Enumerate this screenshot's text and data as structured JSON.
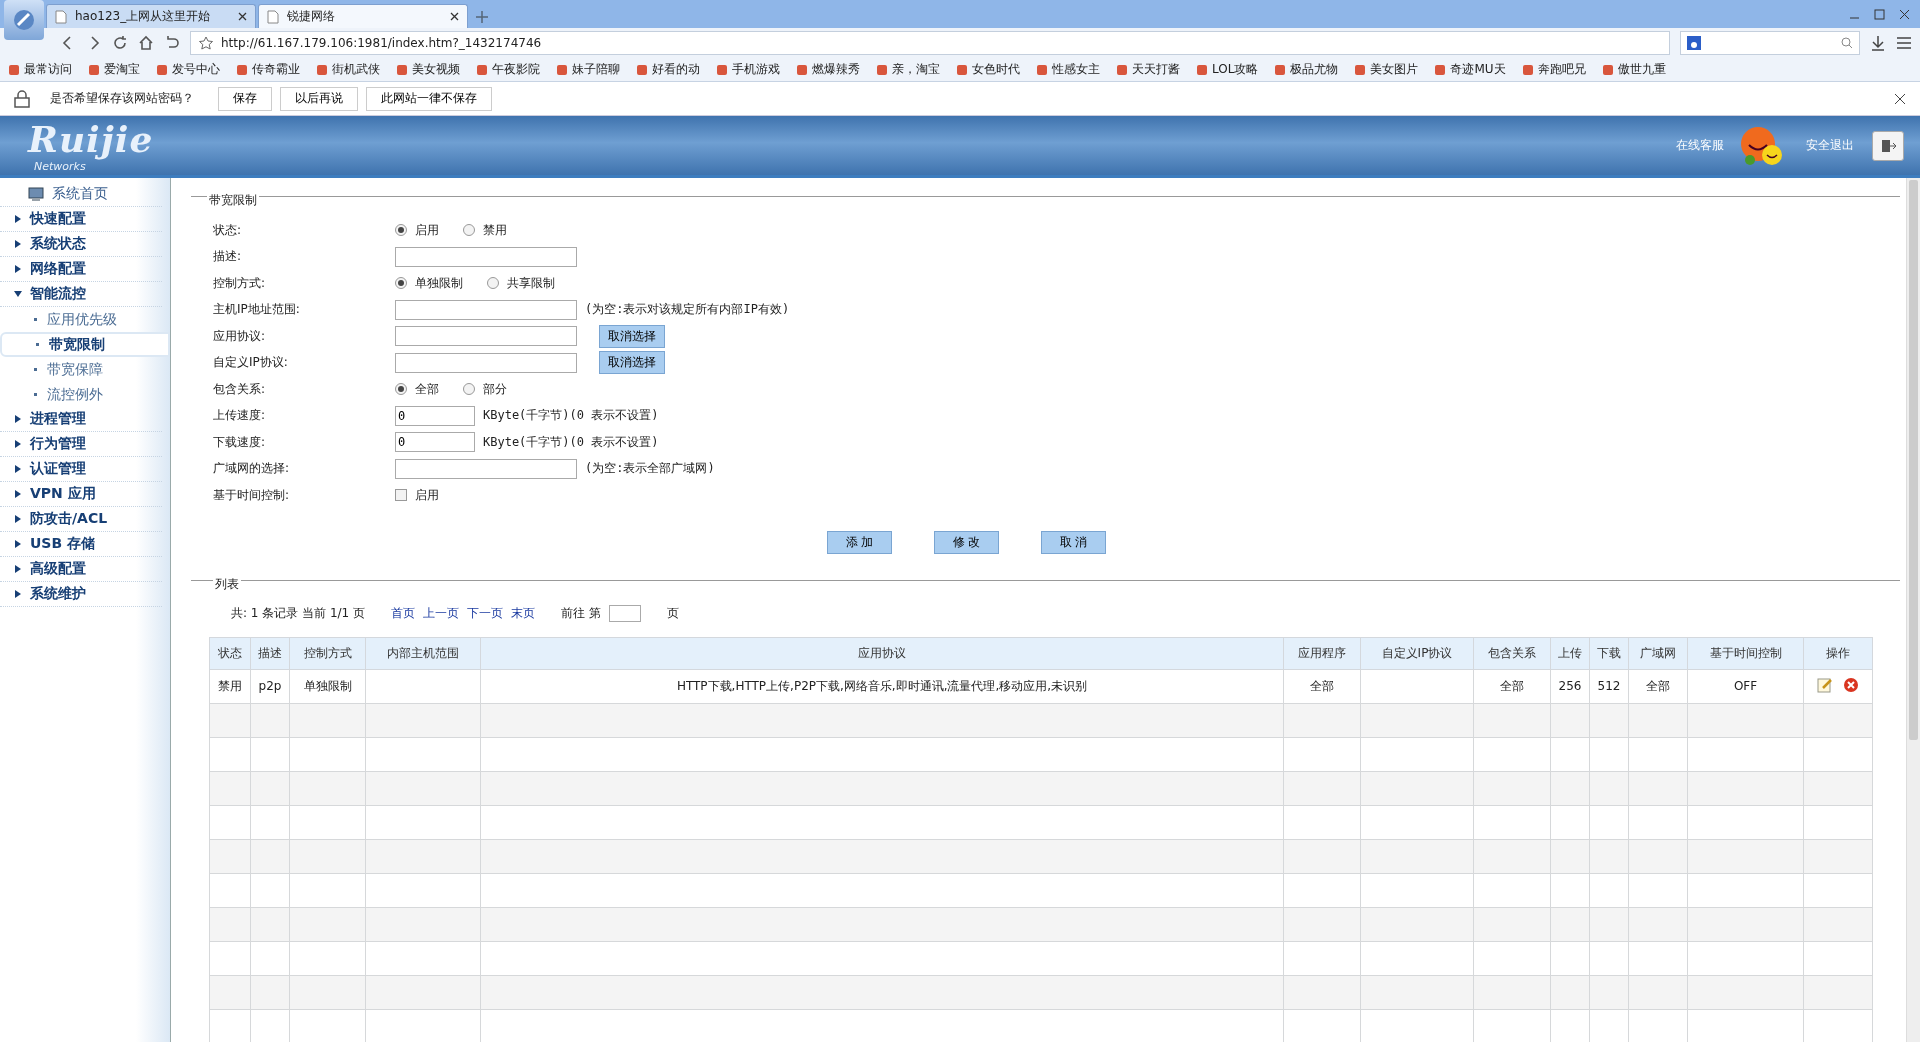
{
  "browser": {
    "tabs": [
      {
        "label": "hao123_上网从这里开始",
        "selected": false
      },
      {
        "label": "锐捷网络",
        "selected": true
      }
    ],
    "url": "http://61.167.179.106:1981/index.htm?_1432174746",
    "bookmarks": [
      "最常访问",
      "爱淘宝",
      "发号中心",
      "传奇霸业",
      "街机武侠",
      "美女视频",
      "午夜影院",
      "妹子陪聊",
      "好看的动",
      "手机游戏",
      "燃爆辣秀",
      "亲，淘宝",
      "女色时代",
      "性感女主",
      "天天打酱",
      "LOL攻略",
      "极品尤物",
      "美女图片",
      "奇迹MU天",
      "奔跑吧兄",
      "傲世九重"
    ],
    "password_prompt": {
      "message": "是否希望保存该网站密码？",
      "buttons": [
        "保存",
        "以后再说",
        "此网站一律不保存"
      ]
    }
  },
  "header": {
    "logo": "Ruijie",
    "logo_sub": "Networks",
    "service_link": "在线客服",
    "logout_link": "安全退出"
  },
  "sidebar": {
    "items": [
      {
        "kind": "home",
        "label": "系统首页"
      },
      {
        "kind": "group",
        "label": "快速配置",
        "expanded": false
      },
      {
        "kind": "group",
        "label": "系统状态",
        "expanded": false
      },
      {
        "kind": "group",
        "label": "网络配置",
        "expanded": false
      },
      {
        "kind": "group",
        "label": "智能流控",
        "expanded": true,
        "children": [
          {
            "label": "应用优先级",
            "selected": false
          },
          {
            "label": "带宽限制",
            "selected": true
          },
          {
            "label": "带宽保障",
            "selected": false
          },
          {
            "label": "流控例外",
            "selected": false
          }
        ]
      },
      {
        "kind": "group",
        "label": "进程管理",
        "expanded": false
      },
      {
        "kind": "group",
        "label": "行为管理",
        "expanded": false
      },
      {
        "kind": "group",
        "label": "认证管理",
        "expanded": false
      },
      {
        "kind": "group",
        "label": "VPN 应用",
        "expanded": false
      },
      {
        "kind": "group",
        "label": "防攻击/ACL",
        "expanded": false
      },
      {
        "kind": "group",
        "label": "USB 存储",
        "expanded": false
      },
      {
        "kind": "group",
        "label": "高级配置",
        "expanded": false
      },
      {
        "kind": "group",
        "label": "系统维护",
        "expanded": false
      }
    ]
  },
  "form": {
    "legend": "带宽限制",
    "rows": [
      {
        "kind": "radio",
        "label": "状态:",
        "options": [
          {
            "label": "启用",
            "selected": true
          },
          {
            "label": "禁用",
            "selected": false
          }
        ]
      },
      {
        "kind": "text",
        "label": "描述:"
      },
      {
        "kind": "radio",
        "label": "控制方式:",
        "options": [
          {
            "label": "单独限制",
            "selected": true
          },
          {
            "label": "共享限制",
            "selected": false
          }
        ]
      },
      {
        "kind": "text",
        "label": "主机IP地址范围:",
        "note": "(为空:表示对该规定所有内部IP有效)"
      },
      {
        "kind": "text",
        "label": "应用协议:",
        "button": "取消选择"
      },
      {
        "kind": "text",
        "label": "自定义IP协议:",
        "button": "取消选择"
      },
      {
        "kind": "radio",
        "label": "包含关系:",
        "options": [
          {
            "label": "全部",
            "selected": true
          },
          {
            "label": "部分",
            "selected": false
          }
        ]
      },
      {
        "kind": "short",
        "label": "上传速度:",
        "value": "0",
        "note": "KByte(千字节)(0 表示不设置)"
      },
      {
        "kind": "short",
        "label": "下载速度:",
        "value": "0",
        "note": "KByte(千字节)(0 表示不设置)"
      },
      {
        "kind": "text",
        "label": "广域网的选择:",
        "note": "(为空:表示全部广域网)"
      },
      {
        "kind": "checkbox",
        "label": "基于时间控制:",
        "option": "启用",
        "checked": false
      }
    ],
    "buttons": [
      "添 加",
      "修 改",
      "取 消"
    ]
  },
  "list": {
    "legend": "列表",
    "summary": "共: 1 条记录 当前 1/1 页",
    "pager_links": [
      "首页",
      "上一页",
      "下一页",
      "末页"
    ],
    "goto_label": "前往 第",
    "goto_suffix": "页",
    "columns": [
      "状态",
      "描述",
      "控制方式",
      "内部主机范围",
      "应用协议",
      "应用程序",
      "自定义IP协议",
      "包含关系",
      "上传",
      "下载",
      "广域网",
      "基于时间控制",
      "操作"
    ],
    "rows": [
      {
        "cells": [
          "禁用",
          "p2p",
          "单独限制",
          null,
          "HTTP下载,HTTP上传,P2P下载,网络音乐,即时通讯,流量代理,移动应用,未识别",
          "全部",
          null,
          "全部",
          "256",
          "512",
          "全部",
          "OFF"
        ]
      }
    ]
  }
}
